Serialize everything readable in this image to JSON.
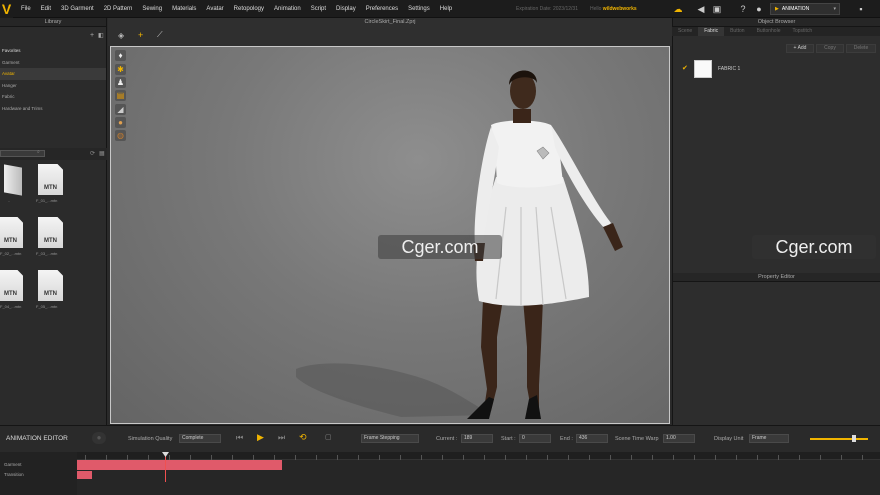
{
  "menubar": {
    "items": [
      "File",
      "Edit",
      "3D Garment",
      "2D Pattern",
      "Sewing",
      "Materials",
      "Avatar",
      "Retopology",
      "Animation",
      "Script",
      "Display",
      "Preferences",
      "Settings",
      "Help"
    ],
    "expire_text": "Expiration Date: 2023/12/31",
    "user_label": "Hello",
    "user_name": "wildwebworks",
    "mode_label": "ANIMATION"
  },
  "library": {
    "title": "Library",
    "tree": [
      "Favorites",
      "Garment",
      "Avatar",
      "Hanger",
      "Fabric",
      "Hardware and Trims"
    ],
    "selected_index": 2,
    "thumbs": [
      {
        "label": "",
        "name": ".."
      },
      {
        "label": "MTN",
        "name": "F_01_...mtn"
      },
      {
        "label": "MTN",
        "name": "F_02_...mtn"
      },
      {
        "label": "MTN",
        "name": "F_03_...mtn"
      },
      {
        "label": "MTN",
        "name": "F_04_...mtn"
      },
      {
        "label": "MTN",
        "name": "F_05_...mtn"
      }
    ]
  },
  "viewport": {
    "title": "CircleSkirt_Final.Zprj"
  },
  "object_browser": {
    "title": "Object Browser",
    "tabs": [
      "Scene",
      "Fabric",
      "Button",
      "Buttonhole",
      "Topstitch"
    ],
    "active_tab": 1,
    "add_label": "+ Add",
    "copy_label": "Copy",
    "delete_label": "Delete",
    "fabric_name": "FABRIC 1"
  },
  "property_editor": {
    "title": "Property Editor"
  },
  "animation_editor": {
    "title": "ANIMATION EDITOR",
    "sim_quality_label": "Simulation Quality",
    "sim_quality_value": "Complete",
    "frame_mode": "Frame Stepping",
    "current_label": "Current :",
    "current_value": "189",
    "start_label": "Start :",
    "start_value": "0",
    "end_label": "End :",
    "end_value": "436",
    "time_warp_label": "Scene Time Warp",
    "time_warp_value": "1.00",
    "display_unit_label": "Display Unit",
    "display_unit_value": "Frame",
    "tracks": [
      "Garment",
      "Transition"
    ]
  },
  "watermarks": [
    "Cger.com",
    "Cger.com"
  ]
}
